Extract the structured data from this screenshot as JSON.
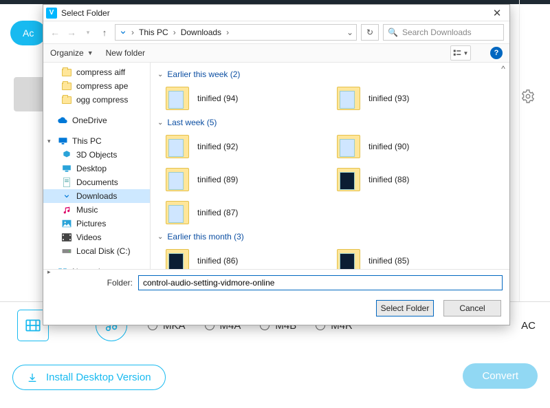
{
  "app": {
    "add_label": "Ac",
    "gear_name": "gear-icon",
    "format_trailing": "AC",
    "formats": [
      "MKA",
      "M4A",
      "M4B",
      "M4R"
    ],
    "install_label": "Install Desktop Version",
    "convert_label": "Convert"
  },
  "dialog": {
    "title": "Select Folder",
    "breadcrumbs": [
      "This PC",
      "Downloads"
    ],
    "search_placeholder": "Search Downloads",
    "organize_label": "Organize",
    "new_folder_label": "New folder",
    "tree": {
      "quick": [
        "compress aiff",
        "compress ape",
        "ogg compress"
      ],
      "onedrive": "OneDrive",
      "thispc": "This PC",
      "thispc_children": [
        "3D Objects",
        "Desktop",
        "Documents",
        "Downloads",
        "Music",
        "Pictures",
        "Videos",
        "Local Disk (C:)"
      ],
      "network": "Network",
      "selected": "Downloads"
    },
    "groups": [
      {
        "title": "Earlier this week (2)",
        "folders": [
          "tinified (94)",
          "tinified (93)"
        ]
      },
      {
        "title": "Last week (5)",
        "folders": [
          "tinified (92)",
          "tinified (90)",
          "tinified (89)",
          "tinified (88)",
          "tinified (87)"
        ]
      },
      {
        "title": "Earlier this month (3)",
        "folders": [
          "tinified (86)",
          "tinified (85)"
        ]
      }
    ],
    "folder_label": "Folder:",
    "folder_value": "control-audio-setting-vidmore-online",
    "select_btn": "Select Folder",
    "cancel_btn": "Cancel"
  }
}
